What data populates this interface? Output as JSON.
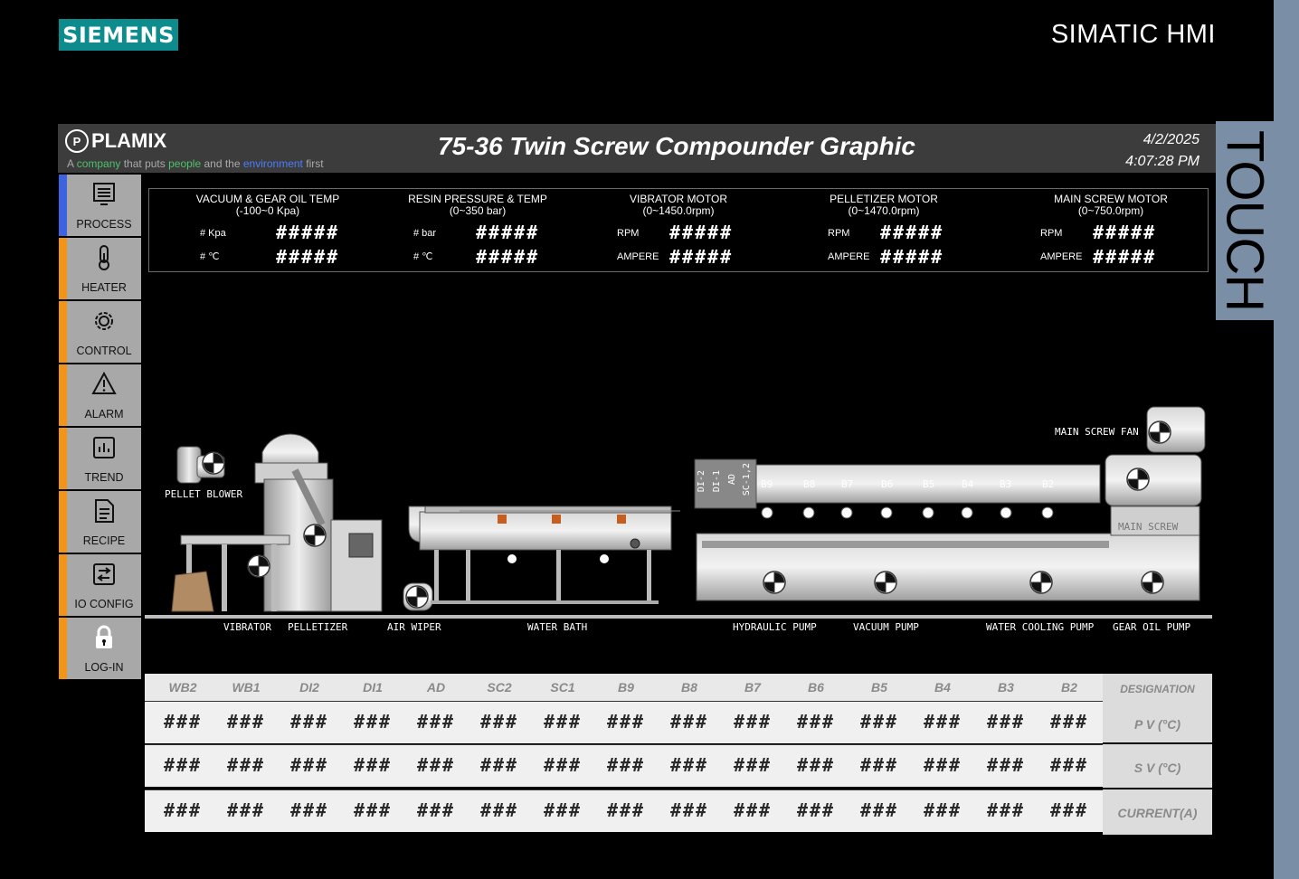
{
  "brand": {
    "siemens": "SIEMENS",
    "hmi_title": "SIMATIC HMI",
    "touch": "TOUCH"
  },
  "header": {
    "logo_mark": "P",
    "logo_text": "PLAMIX",
    "tagline": {
      "p1": "A ",
      "company": "company",
      "p2": " that puts ",
      "people": "people",
      "p3": " and the ",
      "environment": "environment",
      "p4": " first"
    },
    "title": "75-36 Twin Screw Compounder Graphic",
    "date": "4/2/2025",
    "time": "4:07:28 PM"
  },
  "nav": {
    "process": "PROCESS",
    "heater": "HEATER",
    "control": "CONTROL",
    "alarm": "ALARM",
    "trend": "TREND",
    "recipe": "RECIPE",
    "io_config": "IO CONFIG",
    "login": "LOG-IN",
    "active": "PROCESS"
  },
  "readouts": {
    "vacuum": {
      "title": "VACUUM & GEAR OIL TEMP",
      "range": "(-100~0 Kpa)",
      "l1": "# Kpa",
      "v1": "#####",
      "l2": "# ℃",
      "v2": "#####"
    },
    "resin": {
      "title": "RESIN PRESSURE & TEMP",
      "range": "(0~350 bar)",
      "l1": "# bar",
      "v1": "#####",
      "l2": "# ℃",
      "v2": "#####"
    },
    "vibrator": {
      "title": "VIBRATOR MOTOR",
      "range": "(0~1450.0rpm)",
      "l1": "RPM",
      "v1": "#####",
      "l2": "AMPERE",
      "v2": "#####"
    },
    "pelletizer": {
      "title": "PELLETIZER MOTOR",
      "range": "(0~1470.0rpm)",
      "l1": "RPM",
      "v1": "#####",
      "l2": "AMPERE",
      "v2": "#####"
    },
    "main_screw": {
      "title": "MAIN SCREW MOTOR",
      "range": "(0~750.0rpm)",
      "l1": "RPM",
      "v1": "#####",
      "l2": "AMPERE",
      "v2": "#####"
    }
  },
  "machine": {
    "pellet_blower": "PELLET BLOWER",
    "vibrator": "VIBRATOR",
    "pelletizer": "PELLETIZER",
    "air_wiper": "AIR WIPER",
    "water_bath": "WATER BATH",
    "hydraulic_pump": "HYDRAULIC PUMP",
    "vacuum_pump": "VACUUM PUMP",
    "water_cooling_pump": "WATER COOLING PUMP",
    "gear_oil_pump": "GEAR OIL PUMP",
    "main_screw_fan": "MAIN SCREW FAN",
    "main_screw": "MAIN SCREW",
    "dies": [
      "DI-2",
      "DI-1",
      "AD",
      "SC-1,2"
    ],
    "barrels": [
      "B9",
      "B8",
      "B7",
      "B6",
      "B5",
      "B4",
      "B3",
      "B2"
    ]
  },
  "temp_table": {
    "zones": [
      "WB2",
      "WB1",
      "DI2",
      "DI1",
      "AD",
      "SC2",
      "SC1",
      "B9",
      "B8",
      "B7",
      "B6",
      "B5",
      "B4",
      "B3",
      "B2"
    ],
    "designation_header": "DESIGNATION",
    "rows": [
      {
        "label": "P V (°C)",
        "values": [
          "###",
          "###",
          "###",
          "###",
          "###",
          "###",
          "###",
          "###",
          "###",
          "###",
          "###",
          "###",
          "###",
          "###",
          "###"
        ]
      },
      {
        "label": "S V (°C)",
        "values": [
          "###",
          "###",
          "###",
          "###",
          "###",
          "###",
          "###",
          "###",
          "###",
          "###",
          "###",
          "###",
          "###",
          "###",
          "###"
        ]
      },
      {
        "label": "CURRENT(A)",
        "values": [
          "###",
          "###",
          "###",
          "###",
          "###",
          "###",
          "###",
          "###",
          "###",
          "###",
          "###",
          "###",
          "###",
          "###",
          "###"
        ]
      }
    ]
  }
}
